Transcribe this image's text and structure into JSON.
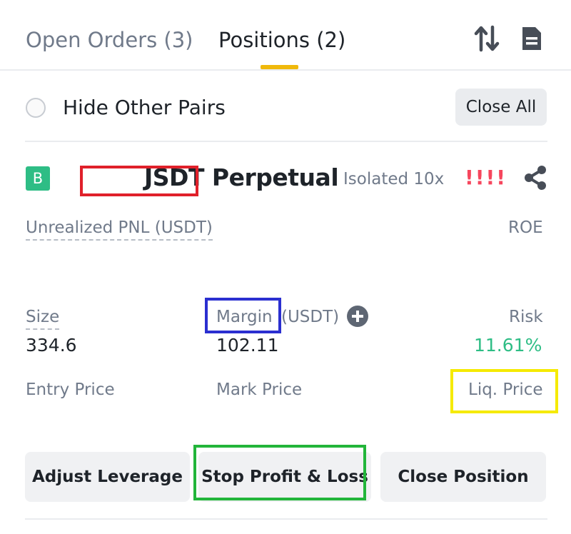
{
  "tabs": {
    "open_orders": "Open Orders (3)",
    "positions": "Positions (2)"
  },
  "icons": {
    "sort": "sort-arrows-icon",
    "orders": "order-history-icon",
    "share": "share-icon",
    "add_margin": "plus-circle-icon"
  },
  "filter": {
    "hide_other_pairs": "Hide Other Pairs",
    "hide_other_pairs_checked": false,
    "close_all": "Close All"
  },
  "position": {
    "side_badge": "B",
    "symbol": "JSDT Perpetual",
    "margin_mode": "Isolated 10x",
    "warning": "!!!!",
    "unrealized_pnl_label": "Unrealized PNL (USDT)",
    "roe_label": "ROE",
    "size_label": "Size",
    "size_value": "334.6",
    "margin_label": "Margin",
    "margin_unit": "(USDT)",
    "margin_value": "102.11",
    "risk_label": "Risk",
    "risk_value": "11.61%",
    "entry_price_label": "Entry Price",
    "mark_price_label": "Mark Price",
    "liq_price_label": "Liq. Price"
  },
  "actions": {
    "adjust_leverage": "Adjust Leverage",
    "stop_profit_loss": "Stop Profit & Loss",
    "close_position": "Close Position"
  },
  "colors": {
    "accent": "#f0b90b",
    "buy": "#2ebd85",
    "sell": "#f6465d",
    "muted_text": "#707a8a"
  }
}
